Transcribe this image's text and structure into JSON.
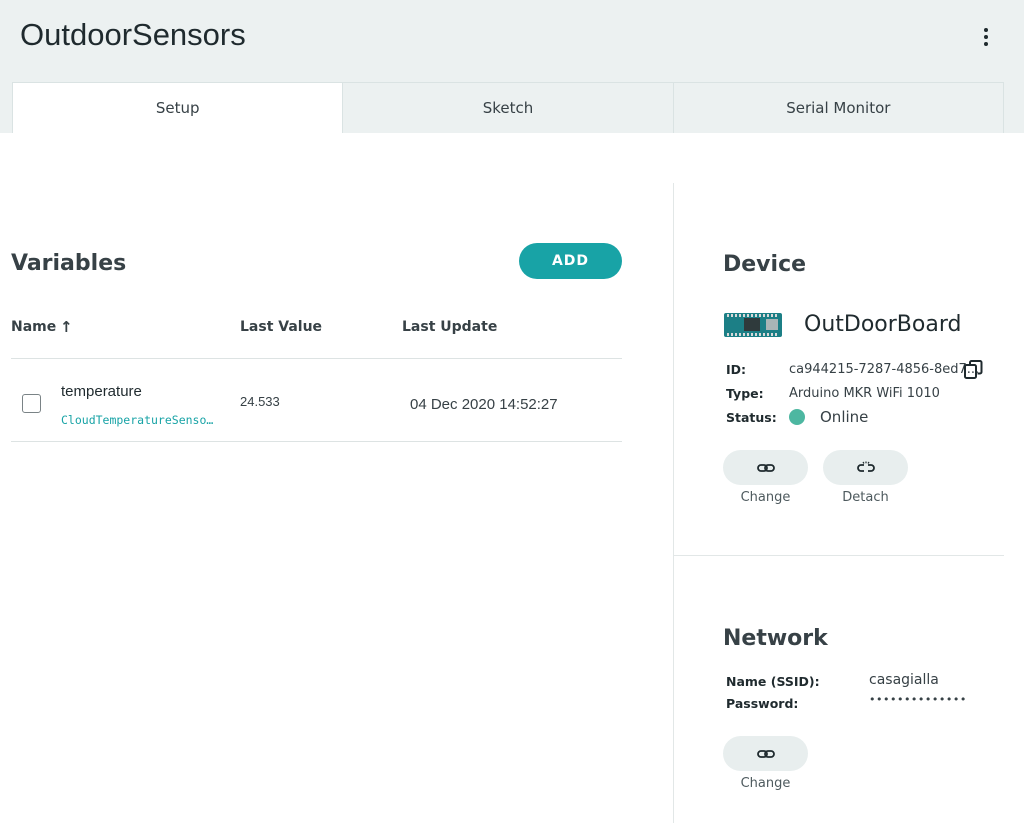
{
  "header": {
    "title": "OutdoorSensors",
    "menu_icon": "more-vertical-icon"
  },
  "tabs": [
    {
      "label": "Setup",
      "active": true
    },
    {
      "label": "Sketch",
      "active": false
    },
    {
      "label": "Serial Monitor",
      "active": false
    }
  ],
  "variables": {
    "title": "Variables",
    "add_label": "ADD",
    "columns": {
      "name": "Name",
      "last_value": "Last Value",
      "last_update": "Last Update"
    },
    "sort_icon": "arrow-up-icon",
    "rows": [
      {
        "name": "temperature",
        "type": "CloudTemperatureSenso…",
        "last_value": "24.533",
        "last_update": "04 Dec 2020 14:52:27",
        "checked": false
      }
    ]
  },
  "device": {
    "title": "Device",
    "name": "OutDoorBoard",
    "icon": "arduino-board-icon",
    "id_label": "ID:",
    "id_value": "ca944215-7287-4856-8ed7...",
    "type_label": "Type:",
    "type_value": "Arduino MKR WiFi 1010",
    "status_label": "Status:",
    "status_value": "Online",
    "status_color": "#4db7a1",
    "change_label": "Change",
    "detach_label": "Detach"
  },
  "network": {
    "title": "Network",
    "ssid_label": "Name (SSID):",
    "ssid_value": "casagialla",
    "password_label": "Password:",
    "password_value": "••••••••••••••",
    "change_label": "Change"
  },
  "colors": {
    "accent": "#18a3a6",
    "header_bg": "#ecf1f1",
    "button_bg": "#e8eeee"
  }
}
